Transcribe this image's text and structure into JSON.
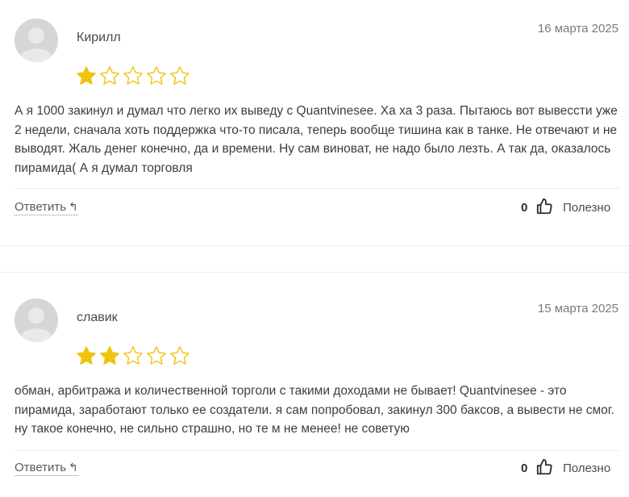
{
  "reviews": [
    {
      "author": "Кирилл",
      "date": "16 марта 2025",
      "rating": 1,
      "max_rating": 5,
      "text": "А я 1000 закинул и думал что легко их выведу с Quantvinesee. Ха ха 3 раза. Пытаюсь вот вывессти уже 2 недели, сначала хоть поддержка что-то писала, теперь вообще тишина как в танке. Не отвечают и не выводят. Жаль денег конечно, да и времени. Ну сам виноват, не надо было лезть. А так да, оказалось пирамида( А я думал торговля",
      "reply_label": "Ответить",
      "likes": "0",
      "useful_label": "Полезно"
    },
    {
      "author": "славик",
      "date": "15 марта 2025",
      "rating": 2,
      "max_rating": 5,
      "text": "обман, арбитража и количественной торголи с такими доходами не бывает! Quantvinesee - это пирамида, заработают только ее создатели. я сам попробовал, закинул 300 баксов, а вывести не смог. ну такое конечно, не сильно страшно, но те м не менее! не советую",
      "reply_label": "Ответить",
      "likes": "0",
      "useful_label": "Полезно"
    }
  ],
  "colors": {
    "star_filled": "#f0c30f",
    "star_empty_stroke": "#f0c30f",
    "avatar_bg": "#d6d6d6"
  },
  "icons": {
    "reply": "reply-arrow-icon",
    "like": "thumbs-up-icon",
    "avatar": "user-avatar-icon",
    "star": "star-icon"
  }
}
